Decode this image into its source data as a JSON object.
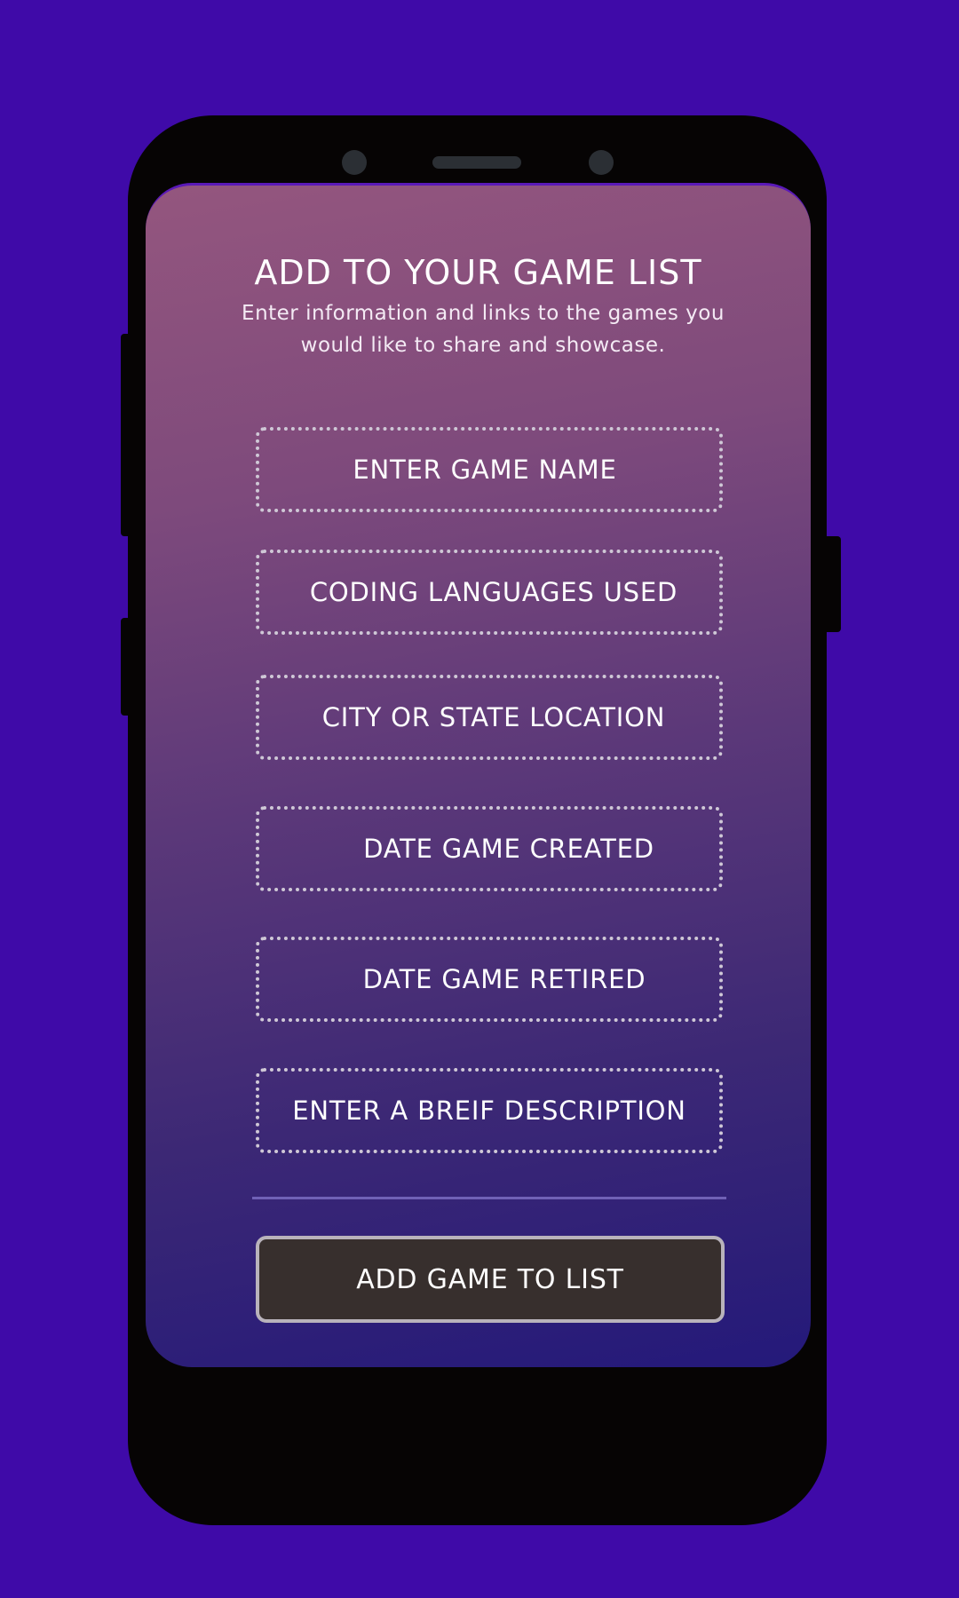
{
  "colors": {
    "background": "#3f0aa8",
    "phone_body": "#060404",
    "gradient_top": "#94567e",
    "gradient_bottom": "#24197a",
    "field_border": "#cfc8d6",
    "button_bg": "#372f2d",
    "button_border": "#b9b3bb"
  },
  "form": {
    "title": "ADD TO YOUR GAME LIST",
    "subtitle": "Enter information and links to the games you would like to share and showcase.",
    "fields": [
      {
        "label": "ENTER GAME NAME"
      },
      {
        "label": "CODING LANGUAGES USED"
      },
      {
        "label": "CITY OR STATE LOCATION"
      },
      {
        "label": "DATE GAME CREATED"
      },
      {
        "label": "DATE GAME RETIRED"
      },
      {
        "label": "ENTER A BREIF DESCRIPTION"
      }
    ],
    "submit_label": "ADD GAME TO LIST"
  }
}
